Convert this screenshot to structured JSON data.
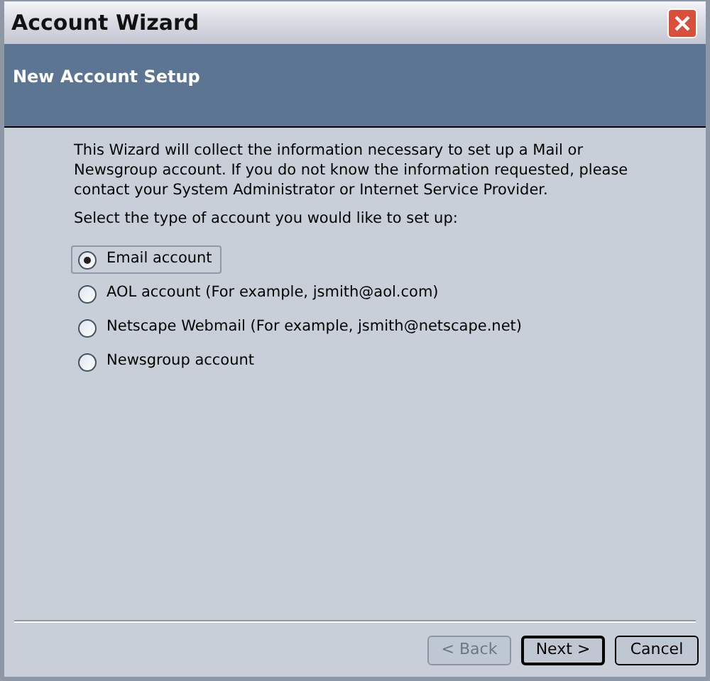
{
  "window": {
    "title": "Account Wizard"
  },
  "header": {
    "title": "New Account Setup"
  },
  "intro": "This Wizard will collect the information necessary to set up a Mail or Newsgroup account. If you do not know the information requested, please contact your System Administrator or Internet Service Provider.",
  "prompt": "Select the type of account you would like to set up:",
  "options": [
    {
      "label": "Email account",
      "selected": true
    },
    {
      "label": "AOL account (For example, jsmith@aol.com)",
      "selected": false
    },
    {
      "label": "Netscape Webmail (For example, jsmith@netscape.net)",
      "selected": false
    },
    {
      "label": "Newsgroup account",
      "selected": false
    }
  ],
  "buttons": [
    {
      "label": "< Back",
      "disabled": true,
      "default": false
    },
    {
      "label": "Next >",
      "disabled": false,
      "default": true
    },
    {
      "label": "Cancel",
      "disabled": false,
      "default": false
    }
  ]
}
